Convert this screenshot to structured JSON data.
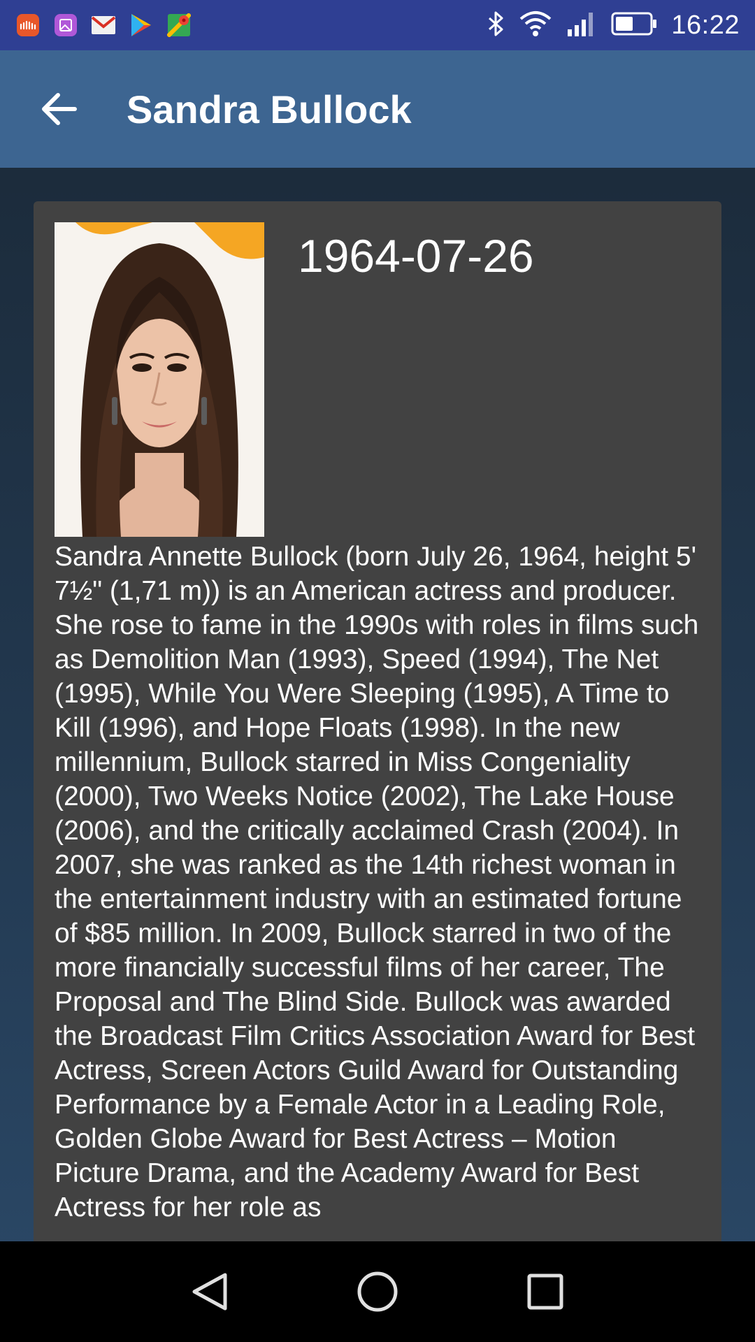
{
  "status_bar": {
    "time": "16:22",
    "notification_icons": [
      "soundcloud-icon",
      "gallery-icon",
      "gmail-icon",
      "play-store-icon",
      "maps-icon"
    ],
    "system_icons": [
      "bluetooth-icon",
      "wifi-icon",
      "signal-icon",
      "battery-icon"
    ]
  },
  "app_bar": {
    "title": "Sandra Bullock",
    "back_icon": "arrow-back-icon"
  },
  "profile": {
    "birth_date": "1964-07-26",
    "bio": "Sandra Annette Bullock (born July 26, 1964, height 5' 7½\" (1,71 m)) is an American actress and producer. She rose to fame in the 1990s with roles in films such as Demolition Man (1993), Speed (1994), The Net (1995), While You Were Sleeping (1995), A Time to Kill (1996), and Hope Floats (1998). In the new millennium, Bullock starred in Miss Congeniality (2000), Two Weeks Notice (2002), The Lake House (2006), and the critically acclaimed Crash (2004). In 2007, she was ranked as the 14th richest woman in the entertainment industry with an estimated fortune of $85 million. In 2009, Bullock starred in two of the more financially successful films of her career, The Proposal and The Blind Side. Bullock was awarded the Broadcast Film Critics Association Award for Best Actress, Screen Actors Guild Award for Outstanding Performance by a Female Actor in a Leading Role, Golden Globe Award for Best Actress – Motion Picture Drama, and the Academy Award for Best Actress for her role as"
  },
  "nav_bar": {
    "buttons": [
      "back-triangle-icon",
      "home-circle-icon",
      "recents-square-icon"
    ]
  },
  "colors": {
    "status_bar": "#2f3f93",
    "app_bar": "#3d6591",
    "card": "#424242",
    "background": "#1c2c3c"
  }
}
